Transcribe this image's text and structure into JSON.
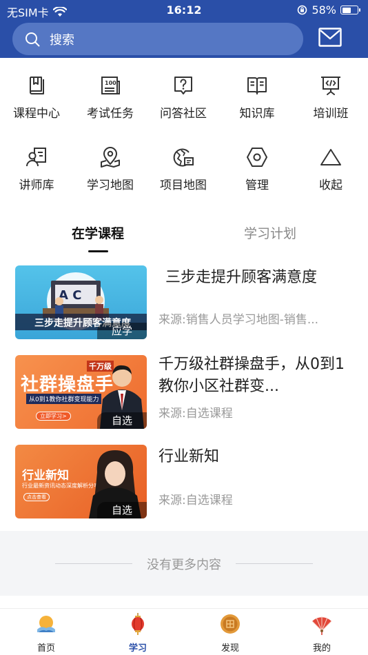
{
  "status_bar": {
    "carrier": "无SIM卡",
    "time": "16:12",
    "battery": "58%",
    "battery_level": 0.58
  },
  "header": {
    "search_placeholder": "搜索"
  },
  "grid": [
    {
      "label": "课程中心",
      "icon": "book-icon"
    },
    {
      "label": "考试任务",
      "icon": "exam-icon"
    },
    {
      "label": "问答社区",
      "icon": "question-icon"
    },
    {
      "label": "知识库",
      "icon": "open-book-icon"
    },
    {
      "label": "培训班",
      "icon": "presentation-icon"
    },
    {
      "label": "讲师库",
      "icon": "lecturer-icon"
    },
    {
      "label": "学习地图",
      "icon": "map-pin-icon"
    },
    {
      "label": "项目地图",
      "icon": "globe-icon"
    },
    {
      "label": "管理",
      "icon": "hexagon-icon"
    },
    {
      "label": "收起",
      "icon": "triangle-up-icon"
    }
  ],
  "tabs": {
    "active": "在学课程",
    "inactive": "学习计划"
  },
  "courses": [
    {
      "title": "三步走提升顾客满意度",
      "source": "来源:销售人员学习地图-销售...",
      "tag": "应学",
      "thumb_text": "三步走提升顾客满意度"
    },
    {
      "title": "千万级社群操盘手，从0到1教你小区社群变...",
      "source": "来源:自选课程",
      "tag": "自选",
      "thumb_text": "社群操盘手",
      "thumb_badge": "千万级",
      "thumb_sub": "从0到1教你社群变现能力",
      "thumb_btn": "立即学习>"
    },
    {
      "title": "行业新知",
      "source": "来源:自选课程",
      "tag": "自选",
      "thumb_text": "行业新知",
      "thumb_sub": "行业最新资讯动态深度解析分享",
      "thumb_btn": "点击查看"
    }
  ],
  "no_more_text": "没有更多内容",
  "bottom_nav": [
    {
      "label": "首页",
      "icon": "home-sun-icon"
    },
    {
      "label": "学习",
      "icon": "lantern-icon"
    },
    {
      "label": "发现",
      "icon": "mooncake-icon"
    },
    {
      "label": "我的",
      "icon": "fan-icon"
    }
  ],
  "colors": {
    "primary": "#2a4fa8",
    "search_bg": "#5577c4",
    "orange": "#f07a3a",
    "text_gray": "#999999"
  }
}
